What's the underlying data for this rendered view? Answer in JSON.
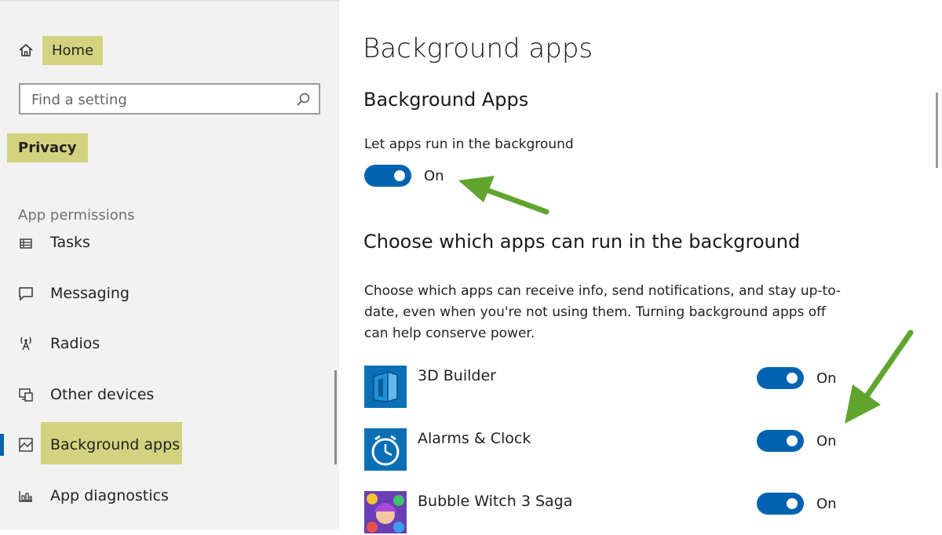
{
  "sidebar": {
    "home_label": "Home",
    "search_placeholder": "Find a setting",
    "category": "Privacy",
    "section": "App permissions",
    "items": [
      {
        "label": "Tasks",
        "icon": "tasks-icon"
      },
      {
        "label": "Messaging",
        "icon": "message-icon"
      },
      {
        "label": "Radios",
        "icon": "radio-tower-icon"
      },
      {
        "label": "Other devices",
        "icon": "devices-icon"
      },
      {
        "label": "Background apps",
        "icon": "background-apps-icon",
        "selected": true
      },
      {
        "label": "App diagnostics",
        "icon": "diagnostics-icon"
      }
    ]
  },
  "main": {
    "page_title": "Background apps",
    "section_title": "Background Apps",
    "master_toggle": {
      "label": "Let apps run in the background",
      "state": "On"
    },
    "choose_title": "Choose which apps can run in the background",
    "description": "Choose which apps can receive info, send notifications, and stay up-to-date, even when you're not using them. Turning background apps off can help conserve power.",
    "apps": [
      {
        "name": "3D Builder",
        "state": "On",
        "icon": "3d-builder-icon"
      },
      {
        "name": "Alarms & Clock",
        "state": "On",
        "icon": "alarm-clock-icon"
      },
      {
        "name": "Bubble Witch 3 Saga",
        "state": "On",
        "icon": "bubble-witch-icon"
      }
    ]
  },
  "colors": {
    "accent": "#0063b1",
    "highlight": "#d3d37f",
    "arrow": "#5fa52e",
    "sidebar_bg": "#f2f2f2"
  }
}
